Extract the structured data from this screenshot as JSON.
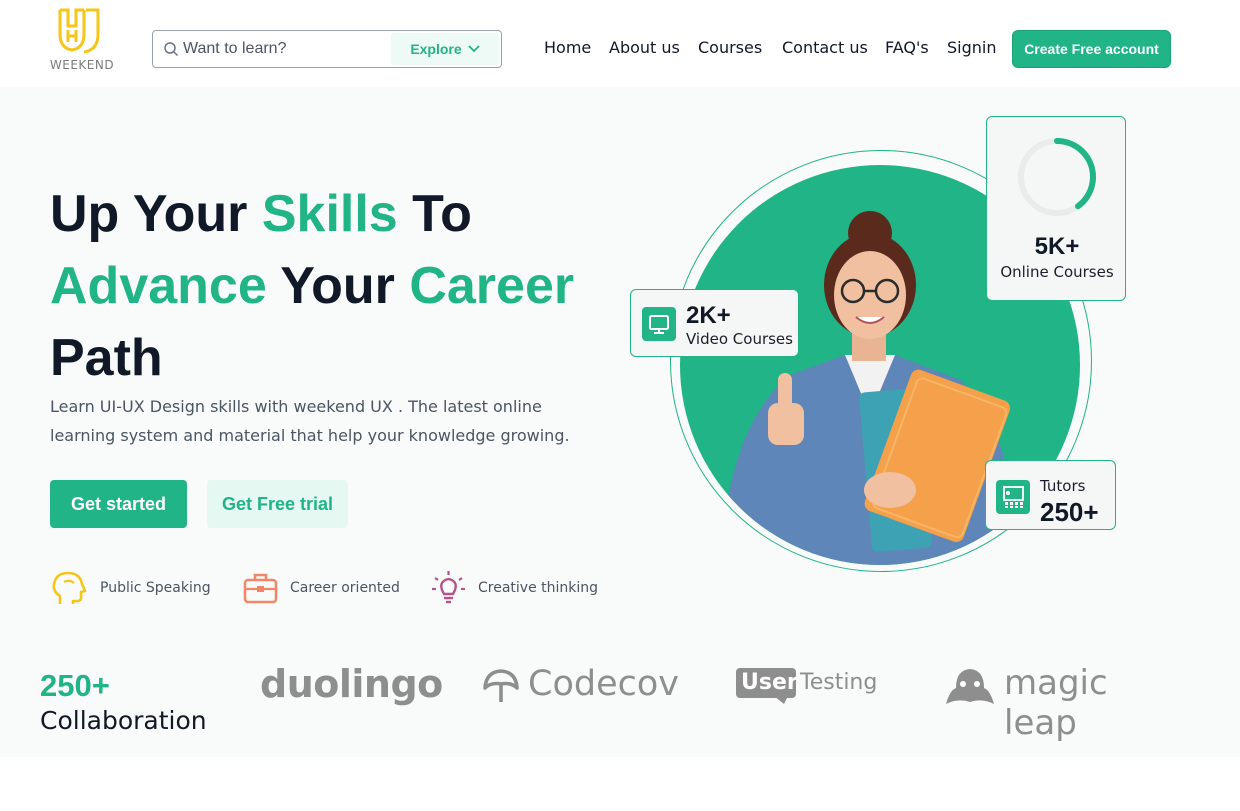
{
  "header": {
    "logo_text": "WEEKEND",
    "search": {
      "placeholder": "Want to learn?",
      "explore_label": "Explore"
    },
    "nav": [
      "Home",
      "About us",
      "Courses",
      "Contact us",
      "FAQ's",
      "Signin"
    ],
    "cta_label": "Create Free account"
  },
  "hero": {
    "headline": {
      "line1_a": "Up Your ",
      "line1_b": "Skills",
      "line1_c": " To",
      "line2_a": "Advance",
      "line2_b": " Your ",
      "line2_c": "Career",
      "line3": "Path"
    },
    "description": "Learn UI-UX Design skills with weekend UX . The latest online learning system and material that help your knowledge growing.",
    "primary_button": "Get started",
    "secondary_button": "Get Free trial",
    "skills": [
      {
        "label": "Public Speaking",
        "icon": "head-icon"
      },
      {
        "label": "Career oriented",
        "icon": "briefcase-icon"
      },
      {
        "label": "Creative thinking",
        "icon": "lightbulb-icon"
      }
    ]
  },
  "stats": {
    "video": {
      "value": "2K+",
      "label": "Video Courses",
      "icon": "monitor-icon"
    },
    "online": {
      "value": "5K+",
      "label": "Online Courses",
      "progress": 0.4
    },
    "tutors": {
      "label": "Tutors",
      "value": "250+",
      "icon": "teacher-icon"
    }
  },
  "partners": {
    "count": "250+",
    "label": "Collaboration",
    "brands": [
      "duolingo",
      "Codecov",
      "User",
      "Testing",
      "magic leap"
    ]
  },
  "colors": {
    "accent": "#20b486",
    "logo": "#f5c518",
    "brand_gray": "#8e8e8e"
  }
}
